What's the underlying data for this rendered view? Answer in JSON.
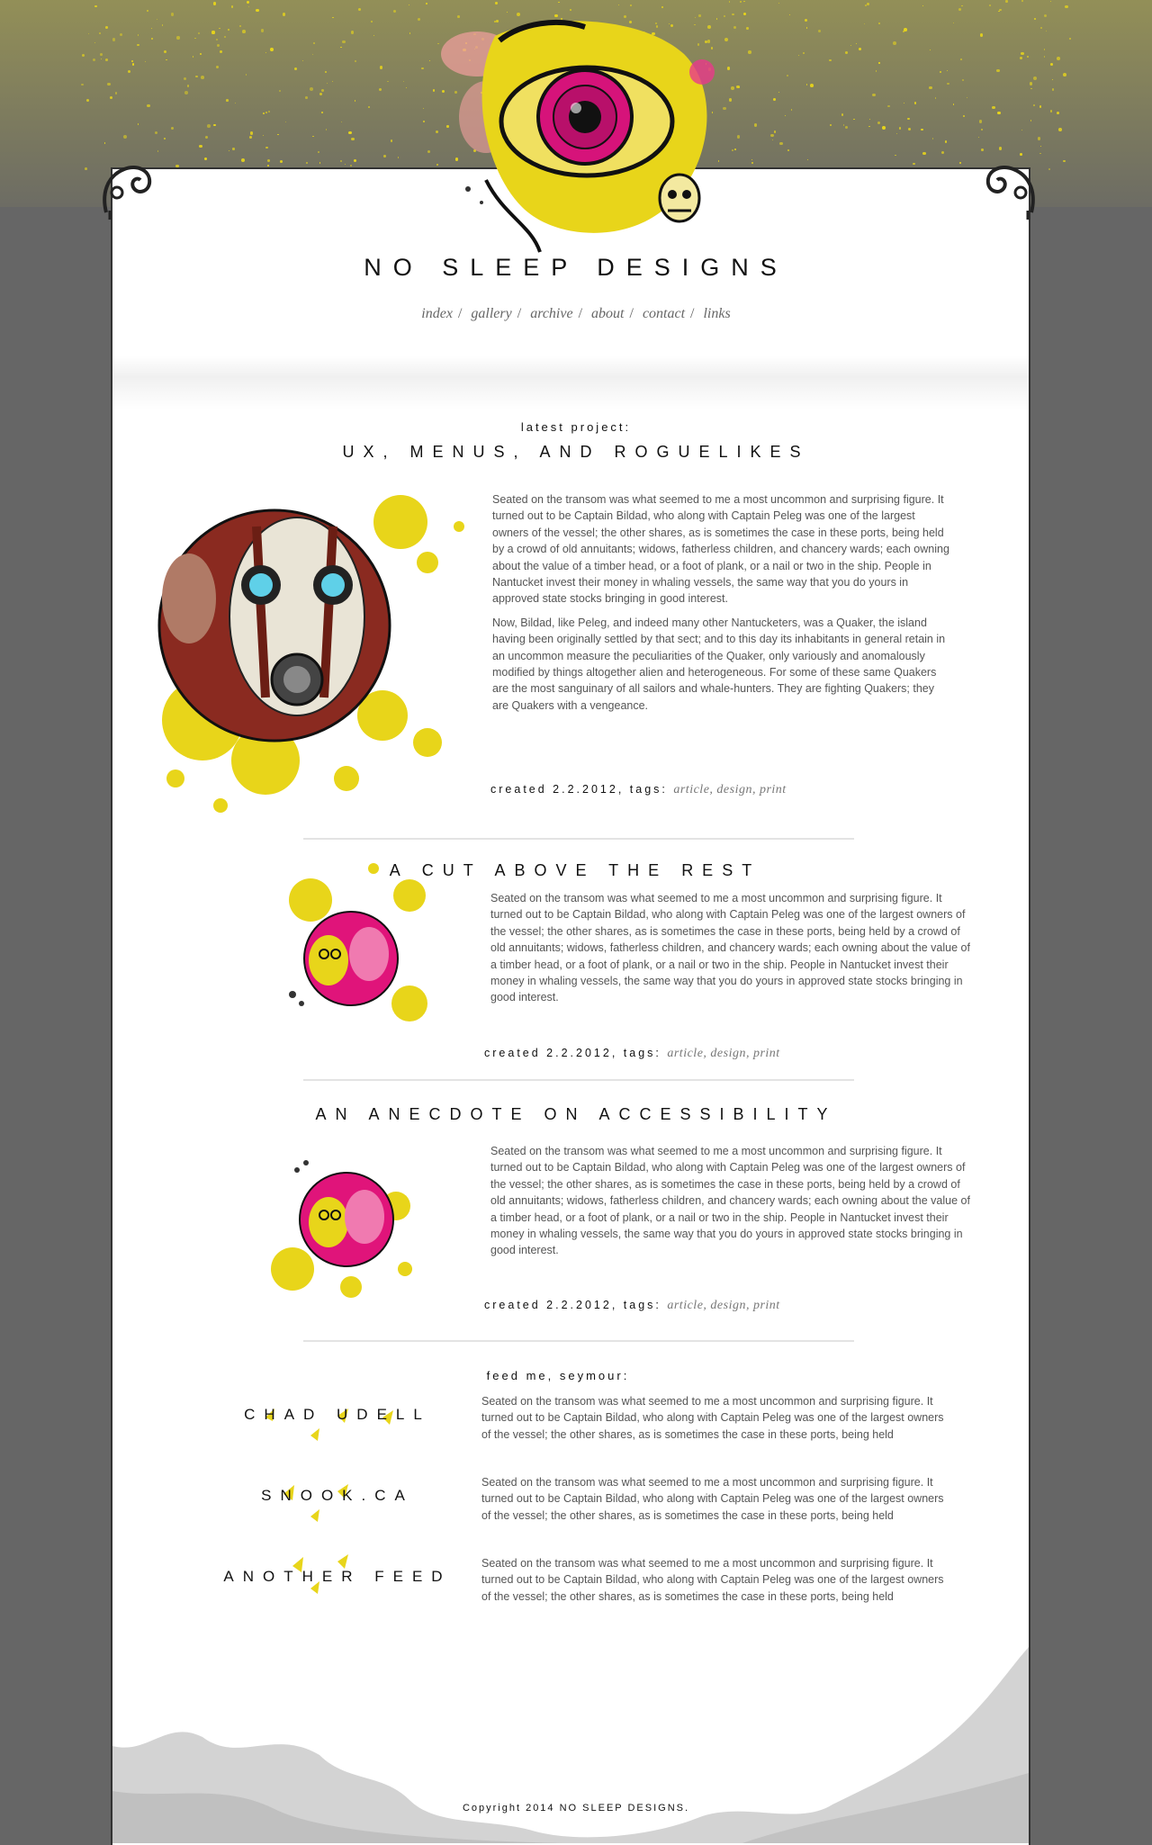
{
  "site": {
    "title": "NO SLEEP DESIGNS"
  },
  "nav": {
    "items": [
      "index",
      "gallery",
      "archive",
      "about",
      "contact",
      "links"
    ]
  },
  "latest": {
    "kicker": "latest project:",
    "title": "UX, MENUS, AND ROGUELIKES",
    "paragraphs": [
      "Seated on the transom was what seemed to me a most uncommon and surprising figure. It turned out to be Captain Bildad, who along with Captain Peleg was one of the largest owners of the vessel; the other shares, as is sometimes the case in these ports, being held by a crowd of old annuitants; widows, fatherless children, and chancery wards; each owning about the value of a timber head, or a foot of plank, or a nail or two in the ship. People in Nantucket invest their money in whaling vessels, the same way that you do yours in approved state stocks bringing in good interest.",
      "Now, Bildad, like Peleg, and indeed many other Nantucketers, was a Quaker, the island having been originally settled by that sect; and to this day its inhabitants in general retain in an uncommon measure the peculiarities of the Quaker, only variously and anomalously modified by things altogether alien and heterogeneous. For some of these same Quakers are the most sanguinary of all sailors and whale-hunters. They are fighting Quakers; they are Quakers with a vengeance."
    ],
    "meta_prefix": "created 2.2.2012, tags:",
    "tags": "article, design, print"
  },
  "posts": [
    {
      "title": "A CUT ABOVE THE REST",
      "text": "Seated on the transom was what seemed to me a most uncommon and surprising figure. It turned out to be Captain Bildad, who along with Captain Peleg was one of the largest owners of the vessel; the other shares, as is sometimes the case in these ports, being held by a crowd of old annuitants; widows, fatherless children, and chancery wards; each owning about the value of a timber head, or a foot of plank, or a nail or two in the ship. People in Nantucket invest their money in whaling vessels, the same way that you do yours in approved state stocks bringing in good interest.",
      "meta_prefix": "created 2.2.2012, tags:",
      "tags": "article, design, print"
    },
    {
      "title": "AN ANECDOTE ON ACCESSIBILITY",
      "text": "Seated on the transom was what seemed to me a most uncommon and surprising figure. It turned out to be Captain Bildad, who along with Captain Peleg was one of the largest owners of the vessel; the other shares, as is sometimes the case in these ports, being held by a crowd of old annuitants; widows, fatherless children, and chancery wards; each owning about the value of a timber head, or a foot of plank, or a nail or two in the ship. People in Nantucket invest their money in whaling vessels, the same way that you do yours in approved state stocks bringing in good interest.",
      "meta_prefix": "created 2.2.2012, tags:",
      "tags": "article, design, print"
    }
  ],
  "feeds": {
    "kicker": "feed me, seymour:",
    "items": [
      {
        "name": "CHAD UDELL",
        "text": "Seated on the transom was what seemed to me a most uncommon and surprising figure. It turned out to be Captain Bildad, who along with Captain Peleg was one of the largest owners of the vessel; the other shares, as is sometimes the case in these ports, being held"
      },
      {
        "name": "SNOOK.CA",
        "text": "Seated on the transom was what seemed to me a most uncommon and surprising figure. It turned out to be Captain Bildad, who along with Captain Peleg was one of the largest owners of the vessel; the other shares, as is sometimes the case in these ports, being held"
      },
      {
        "name": "ANOTHER FEED",
        "text": "Seated on the transom was what seemed to me a most uncommon and surprising figure. It turned out to be Captain Bildad, who along with Captain Peleg was one of the largest owners of the vessel; the other shares, as is sometimes the case in these ports, being held"
      }
    ]
  },
  "footer": {
    "copyright": "Copyright 2014 NO SLEEP DESIGNS."
  },
  "colors": {
    "background": "#666666",
    "accent_yellow": "#e8d51a",
    "accent_pink": "#e0147a",
    "paper": "#ffffff"
  }
}
